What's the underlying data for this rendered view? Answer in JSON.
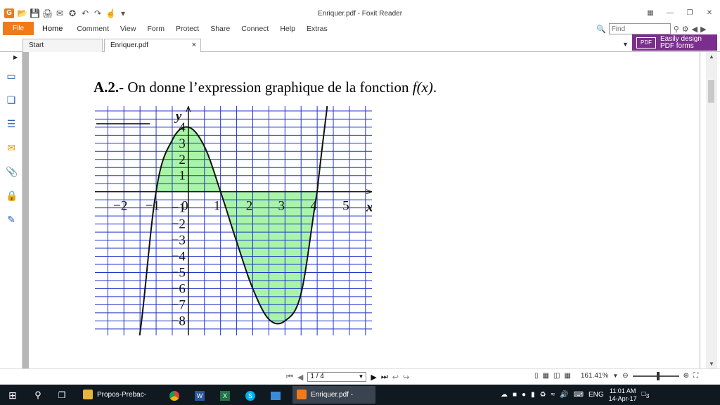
{
  "window": {
    "title": "Enriquer.pdf - Foxit Reader"
  },
  "ribbon": {
    "file": "File",
    "tabs": [
      "Home",
      "Comment",
      "View",
      "Form",
      "Protect",
      "Share",
      "Connect",
      "Help",
      "Extras"
    ],
    "search_placeholder": "Find"
  },
  "doc_tabs": {
    "start": "Start",
    "active": "Enriquer.pdf",
    "close": "×"
  },
  "ad": {
    "line1": "Easily design",
    "line2": "PDF forms"
  },
  "document": {
    "heading_bold": "A.2.-",
    "heading_text": " On donne l’expression graphique de la fonction ",
    "heading_math": "f(x)",
    "heading_end": "."
  },
  "chart_data": {
    "type": "line",
    "x": [
      -1.6,
      -1,
      -0.5,
      0,
      0.5,
      1,
      1.5,
      2,
      2.5,
      3,
      3.5,
      4,
      4.3,
      4.5
    ],
    "y": [
      -9.9,
      0,
      3.2,
      4,
      2.8,
      0,
      -3.1,
      -6,
      -7.9,
      -8,
      -6.3,
      0,
      5.1,
      9.8
    ],
    "shaded_regions": [
      [
        -1,
        1
      ],
      [
        1,
        4
      ]
    ],
    "xlabel": "x",
    "ylabel": "y",
    "xlim": [
      -2.9,
      5.7
    ],
    "ylim": [
      -8.9,
      5.3
    ],
    "x_ticks": [
      "−2",
      "−1",
      "0",
      "1",
      "2",
      "3",
      "4",
      "5"
    ],
    "y_ticks": [
      "4",
      "3",
      "2",
      "1",
      "−1",
      "−2",
      "−3",
      "−4",
      "−5",
      "−6",
      "−7",
      "−8"
    ],
    "grid": true,
    "colors": {
      "grid": "#2233cc",
      "curve": "#111111",
      "fill": "#a8f5a8"
    }
  },
  "status": {
    "page": "1 / 4",
    "zoom": "161.41%"
  },
  "taskbar": {
    "apps": [
      "Propos-Prebac-bac...",
      "Enriquer.pdf - Foxit..."
    ],
    "lang": "ENG",
    "time": "11:01 AM",
    "date": "14-Apr-17",
    "notif_count": "3"
  }
}
